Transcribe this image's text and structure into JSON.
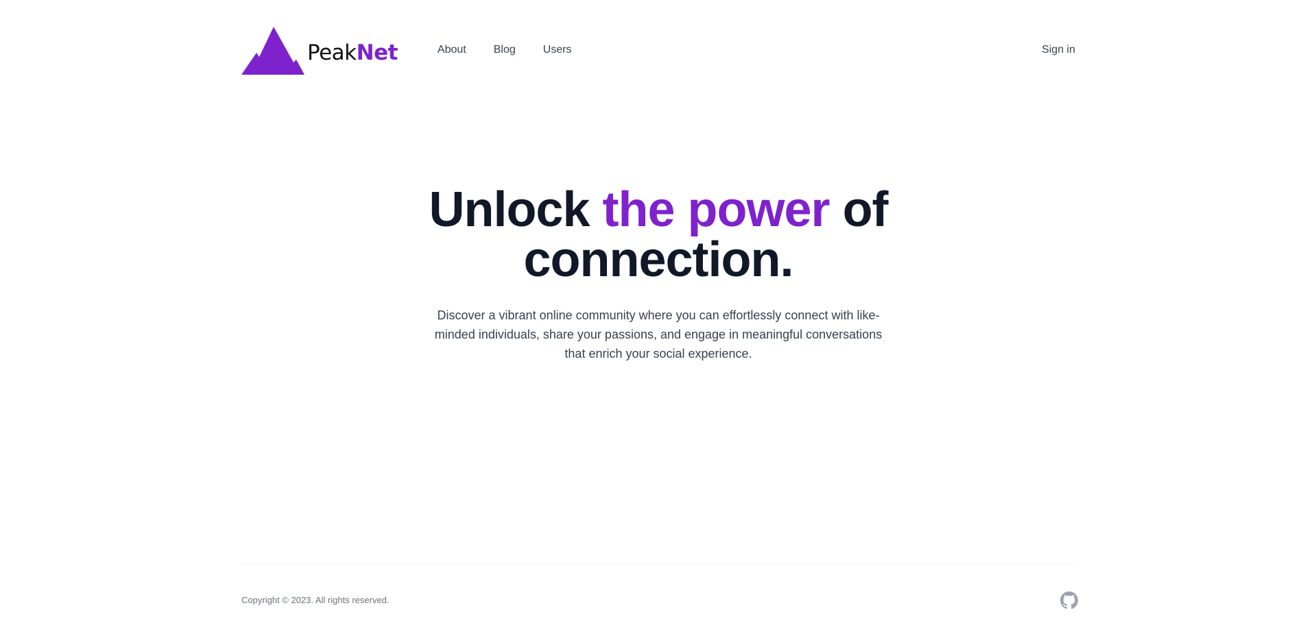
{
  "brand": {
    "name_part1": "Peak",
    "name_part2": "Net",
    "accent_color": "#7e22ce",
    "logo_icon": "mountain-icon"
  },
  "nav": {
    "items": [
      {
        "label": "About"
      },
      {
        "label": "Blog"
      },
      {
        "label": "Users"
      }
    ],
    "sign_in": "Sign in"
  },
  "hero": {
    "title_part1": "Unlock ",
    "title_accent": "the power",
    "title_part2": " of connection.",
    "description": "Discover a vibrant online community where you can effortlessly connect with like-minded individuals, share your passions, and engage in meaningful conversations that enrich your social experience."
  },
  "footer": {
    "copyright": "Copyright © 2023. All rights reserved.",
    "github_icon": "github-icon"
  }
}
